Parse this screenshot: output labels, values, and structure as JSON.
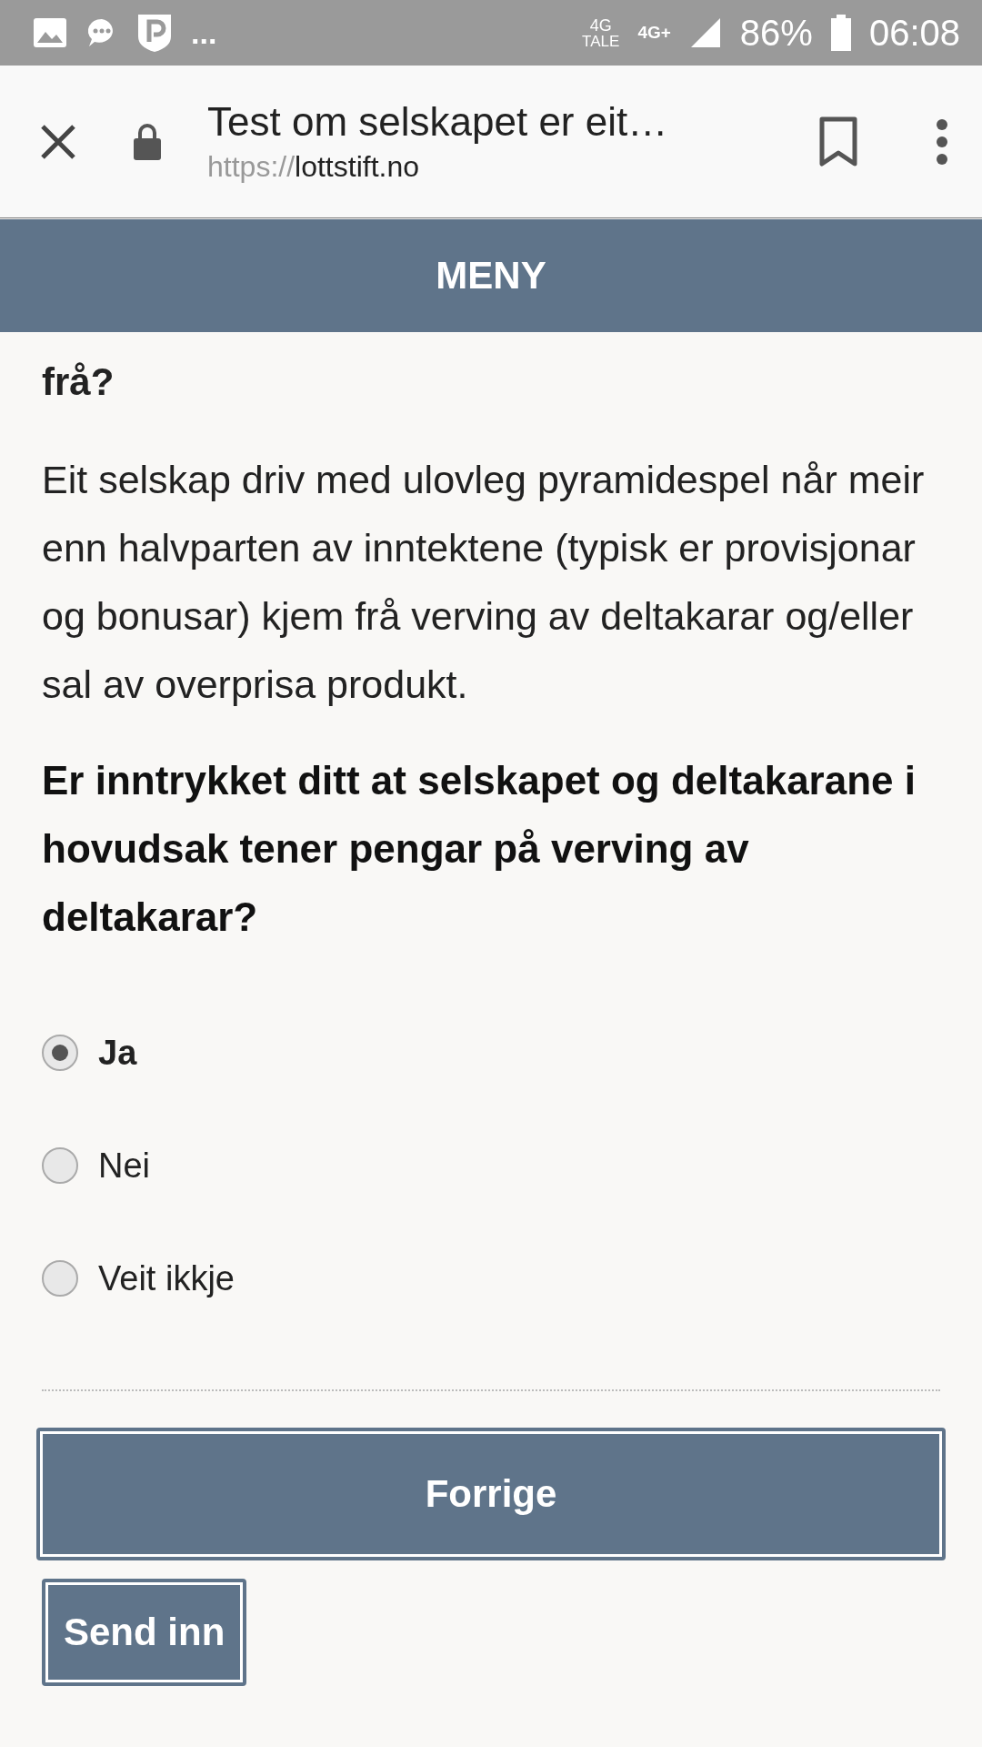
{
  "status_bar": {
    "more": "...",
    "network_1": "4G",
    "network_1_sub": "TALE",
    "network_2": "4G+",
    "battery": "86%",
    "time": "06:08"
  },
  "browser_bar": {
    "title": "Test om selskapet er eit…",
    "url_scheme": "https://",
    "url_host": "lottstift.no"
  },
  "menu_bar": {
    "label": "MENY"
  },
  "heading": "frå?",
  "description": "Eit selskap driv med ulovleg pyramidespel når meir enn halvparten av inntektene (typisk er provisjonar og bonusar) kjem frå verving av deltakarar og/eller sal av overprisa produkt.",
  "question": "Er inntrykket ditt at selskapet og deltakarane i hovudsak tener pengar på verving av deltakarar?",
  "options": [
    {
      "label": "Ja",
      "selected": true
    },
    {
      "label": "Nei",
      "selected": false
    },
    {
      "label": "Veit ikkje",
      "selected": false
    }
  ],
  "buttons": [
    {
      "label": "Forrige",
      "kind": "wide"
    },
    {
      "label": "Send inn",
      "kind": "compact"
    }
  ]
}
